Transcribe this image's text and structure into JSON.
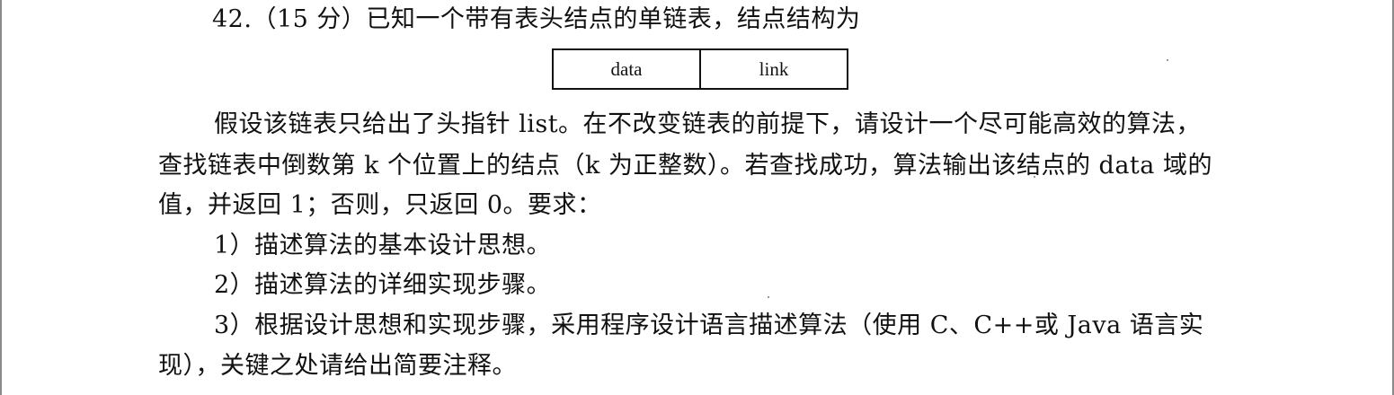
{
  "question": {
    "header": "42.（15 分）已知一个带有表头结点的单链表，结点结构为",
    "node_fields": [
      "data",
      "link"
    ],
    "paragraph_lines": [
      "假设该链表只给出了头指针 list。在不改变链表的前提下，请设计一个尽可能高效的算法，",
      "查找链表中倒数第 k 个位置上的结点（k 为正整数）。若查找成功，算法输出该结点的 data 域的",
      "值，并返回 1；否则，只返回 0。要求："
    ],
    "requirements": [
      "1）描述算法的基本设计思想。",
      "2）描述算法的详细实现步骤。",
      "3）根据设计思想和实现步骤，采用程序设计语言描述算法（使用 C、C++或 Java 语言实"
    ],
    "requirement_continuation": "现），关键之处请给出简要注释。"
  }
}
